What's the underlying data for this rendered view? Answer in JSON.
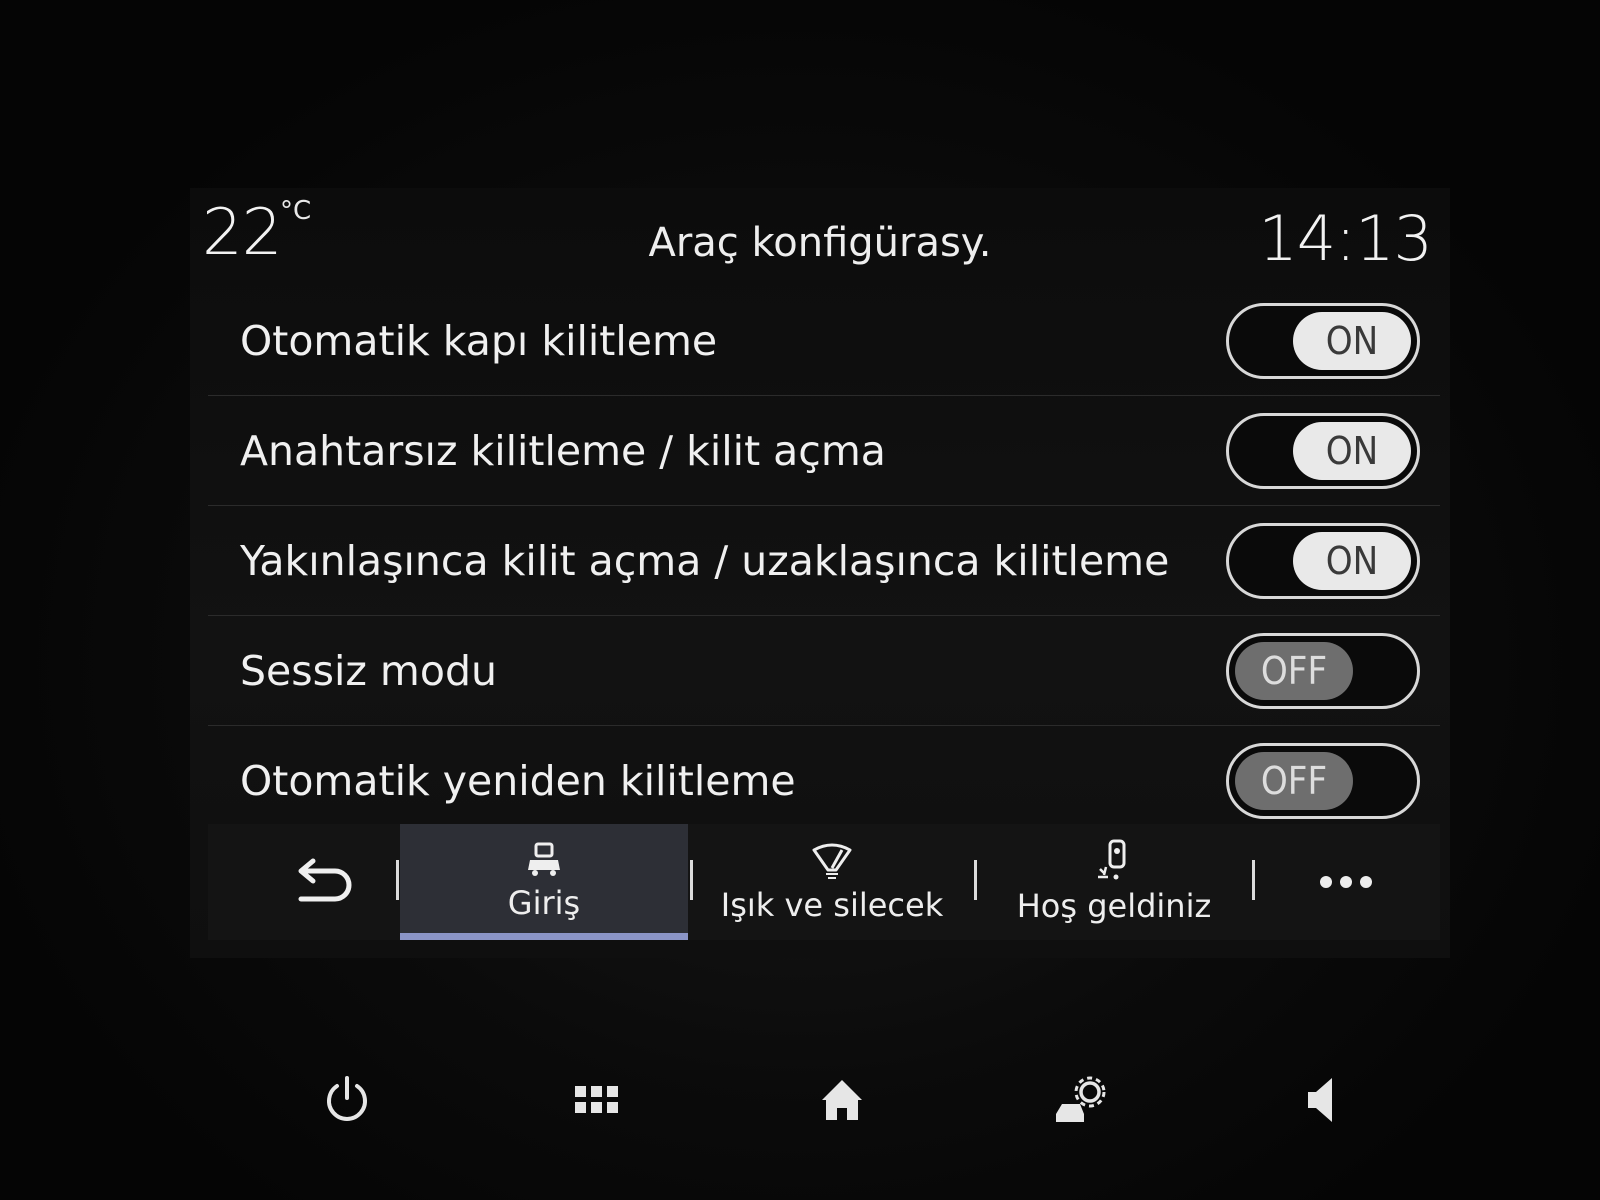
{
  "status": {
    "temperature": "22",
    "temperature_unit": "°C",
    "title": "Araç konfigürasy.",
    "time": "14:13"
  },
  "settings": [
    {
      "label": "Otomatik kapı kilitleme",
      "state": "ON"
    },
    {
      "label": "Anahtarsız kilitleme / kilit açma",
      "state": "ON"
    },
    {
      "label": "Yakınlaşınca kilit açma / uzaklaşınca kilitleme",
      "state": "ON"
    },
    {
      "label": "Sessiz modu",
      "state": "OFF"
    },
    {
      "label": "Otomatik yeniden kilitleme",
      "state": "OFF"
    }
  ],
  "tabs": [
    {
      "label": "Giriş",
      "icon": "car-lock-icon",
      "active": true
    },
    {
      "label": "Işık ve silecek",
      "icon": "wiper-light-icon",
      "active": false
    },
    {
      "label": "Hoş geldiniz",
      "icon": "welcome-person-icon",
      "active": false
    }
  ],
  "bottom_keys": [
    "power-icon",
    "apps-grid-icon",
    "home-icon",
    "vehicle-settings-icon",
    "volume-icon"
  ],
  "colors": {
    "active_tab_underline": "#8b95c7",
    "toggle_on_knob": "#e9e9e9",
    "toggle_off_knob": "#6e6e6e"
  }
}
